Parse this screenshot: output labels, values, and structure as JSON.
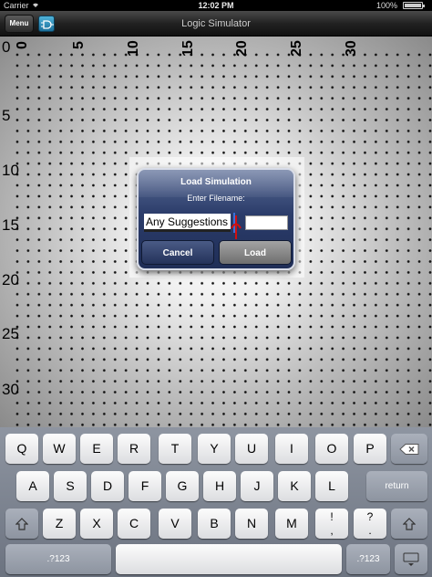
{
  "status_bar": {
    "carrier": "Carrier",
    "time": "12:02 PM",
    "battery": "100%"
  },
  "nav_bar": {
    "menu_label": "Menu",
    "title": "Logic Simulator"
  },
  "canvas": {
    "column_labels": [
      "0",
      "5",
      "10",
      "15",
      "20",
      "25",
      "30"
    ],
    "row_labels": [
      "0",
      "5",
      "10",
      "15",
      "20",
      "25",
      "30"
    ]
  },
  "dialog": {
    "title": "Load Simulation",
    "message": "Enter Filename:",
    "filename_value": "Any Suggestions",
    "cancel_label": "Cancel",
    "load_label": "Load"
  },
  "keyboard": {
    "row1": [
      "Q",
      "W",
      "E",
      "R",
      "T",
      "Y",
      "U",
      "I",
      "O",
      "P"
    ],
    "row2": [
      "A",
      "S",
      "D",
      "F",
      "G",
      "H",
      "J",
      "K",
      "L"
    ],
    "row3": [
      "Z",
      "X",
      "C",
      "V",
      "B",
      "N",
      "M",
      "!",
      ","
    ],
    "row3_alt": [
      "",
      "",
      "",
      "",
      "",
      "",
      "",
      "",
      ""
    ],
    "punct_row3": [
      "!",
      "?"
    ],
    "return_label": "return",
    "numbers_label": ".?123"
  },
  "colors": {
    "dialog_blue": "#2b3c6a",
    "cursor_red": "#d01010"
  }
}
